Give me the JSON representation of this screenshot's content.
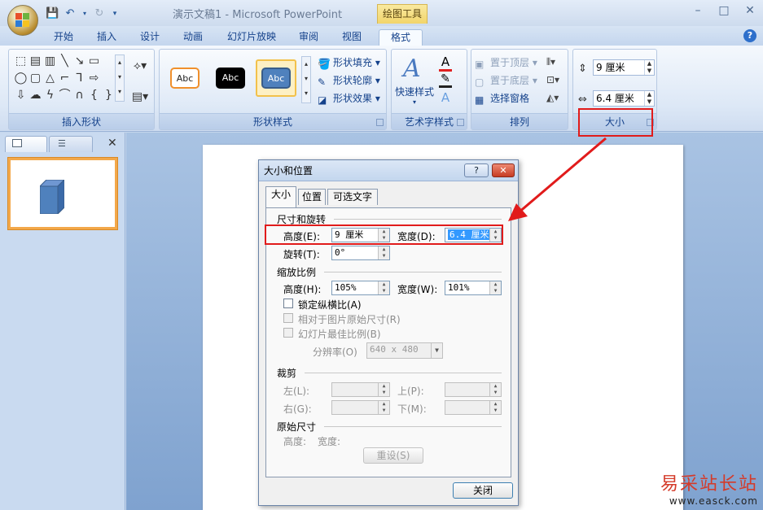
{
  "window": {
    "doc_title": "演示文稿1 - Microsoft PowerPoint",
    "context_tab_title": "绘图工具"
  },
  "tabs": [
    "开始",
    "插入",
    "设计",
    "动画",
    "幻灯片放映",
    "审阅",
    "视图",
    "格式"
  ],
  "ribbon": {
    "groups": {
      "insert_shapes": "插入形状",
      "shape_styles": "形状样式",
      "wordart_styles": "艺术字样式",
      "arrange": "排列",
      "size": "大小"
    },
    "style_sample": "Abc",
    "shape_fill": "形状填充",
    "shape_outline": "形状轮廓",
    "shape_effects": "形状效果",
    "quick_styles": "快速样式",
    "bring_to_front": "置于顶层",
    "send_to_back": "置于底层",
    "selection_pane": "选择窗格",
    "height_value": "9 厘米",
    "width_value": "6.4 厘米"
  },
  "dialog": {
    "title": "大小和位置",
    "help": "?",
    "close_x": "✕",
    "tabs": [
      "大小",
      "位置",
      "可选文字"
    ],
    "section_size_rotate": "尺寸和旋转",
    "height_label": "高度(E):",
    "height_value": "9 厘米",
    "width_label": "宽度(D):",
    "width_value": "6.4 厘米",
    "rotation_label": "旋转(T):",
    "rotation_value": "0°",
    "section_scale": "缩放比例",
    "scale_height_label": "高度(H):",
    "scale_height_value": "105%",
    "scale_width_label": "宽度(W):",
    "scale_width_value": "101%",
    "lock_aspect": "锁定纵横比(A)",
    "relative_original": "相对于图片原始尺寸(R)",
    "best_scale": "幻灯片最佳比例(B)",
    "resolution_label": "分辨率(O)",
    "resolution_value": "640 x 480",
    "section_crop": "裁剪",
    "crop_left": "左(L):",
    "crop_top": "上(P):",
    "crop_right": "右(G):",
    "crop_bottom": "下(M):",
    "section_original": "原始尺寸",
    "orig_height": "高度:",
    "orig_width": "宽度:",
    "reset_button": "重设(S)",
    "close_button": "关闭"
  },
  "watermark": {
    "cn": "易采站长站",
    "url": "www.easck.com"
  },
  "colors": {
    "accent_red": "#e11b1b",
    "context_tab": "#f2d56a"
  }
}
